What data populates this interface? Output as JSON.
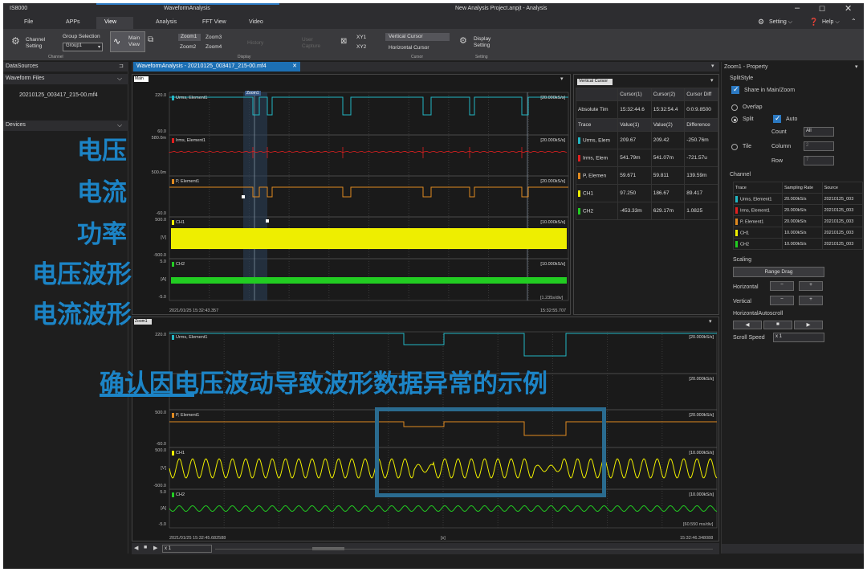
{
  "titlebar": {
    "app": "IS8000",
    "doc": "WaveformAnalysis",
    "project": "New Analysis Project.anpjt - Analysis",
    "setting": "Setting",
    "help": "Help"
  },
  "tabs": [
    "File",
    "APPs",
    "View",
    "Analysis",
    "FFT View",
    "Video"
  ],
  "ribbon": {
    "channel_setting": "Channel Setting",
    "channel_group": "Channel",
    "group_selection": "Group Selection",
    "group_value": "Group1",
    "main_view": "Main View",
    "zoom1": "Zoom1",
    "zoom2": "Zoom2",
    "zoom3": "Zoom3",
    "zoom4": "Zoom4",
    "history": "History",
    "user_capture": "User Capture",
    "display_group": "Display",
    "xy1": "XY1",
    "xy2": "XY2",
    "vertical_cursor": "Vertical Cursor",
    "horizontal_cursor": "Horizontal Cursor",
    "cursor_group": "Cursor",
    "display_setting": "Display Setting",
    "setting_group": "Setting"
  },
  "datasources": {
    "title": "DataSources",
    "waveform_files": "Waveform Files",
    "file": "20210125_003417_215-00.mf4",
    "devices": "Devices"
  },
  "doc_tab": "WaveformAnalysis - 20210125_003417_215-00.mf4",
  "main": {
    "label": "Main",
    "start_time": "2021/01/25 15:32:43.357",
    "end_time": "15:32:55.707",
    "div": "[1.235s/div]",
    "zoom_tag": "Zoom1",
    "traces": [
      {
        "name": "Urms, Element1",
        "color": "#22b7c4",
        "top": "220.0",
        "mid": "",
        "bottom": "60.0",
        "rate": "[20.000kS/s]"
      },
      {
        "name": "Irms, Element1",
        "color": "#e02020",
        "top": "580.0m",
        "mid": "",
        "bottom": "500.0m",
        "rate": "[20.000kS/s]"
      },
      {
        "name": "P, Element1",
        "color": "#e08a20",
        "top": "",
        "mid": "",
        "bottom": "-60.0",
        "rate": "[20.000kS/s]"
      },
      {
        "name": "CH1",
        "color": "#eeee00",
        "top": "500.0",
        "mid": "[V]",
        "bottom": "-500.0",
        "rate": "[10.000kS/s]"
      },
      {
        "name": "CH2",
        "color": "#22cc22",
        "top": "5.0",
        "mid": "[A]",
        "bottom": "-5.0",
        "rate": "[10.000kS/s]"
      }
    ]
  },
  "zoom": {
    "label": "Zoom1",
    "start_time": "2021/01/25 15:32:45.682588",
    "end_time": "15:32:46.348088",
    "div": "[60.550 ms/div]",
    "xunit": "[s]",
    "traces": [
      {
        "name": "Urms, Element1",
        "top": "220.0",
        "mid": "",
        "bottom": "",
        "rate": "[20.000kS/s]"
      },
      {
        "name": "",
        "top": "",
        "mid": "",
        "bottom": "",
        "rate": "[20.000kS/s]"
      },
      {
        "name": "P, Element1",
        "top": "500.0",
        "mid": "",
        "bottom": "-60.0",
        "rate": "[20.000kS/s]"
      },
      {
        "name": "CH1",
        "top": "500.0",
        "mid": "[V]",
        "bottom": "-500.0",
        "rate": "[10.000kS/s]"
      },
      {
        "name": "CH2",
        "top": "5.0",
        "mid": "[A]",
        "bottom": "-5.0",
        "rate": "[10.000kS/s]"
      }
    ]
  },
  "cursor": {
    "title": "Vertical Cursor",
    "col1": "Cursor(1)",
    "col2": "Cursor(2)",
    "col3": "Cursor Diff",
    "abs_label": "Absolute Tim",
    "abs1": "15:32:44.6",
    "abs2": "15:32:54.4",
    "absd": "0:0:9.8500",
    "hdr": [
      "Trace",
      "Value(1)",
      "Value(2)",
      "Difference"
    ],
    "rows": [
      {
        "name": "Urms, Elem",
        "color": "#22b7c4",
        "v1": "209.67",
        "v2": "209.42",
        "d": "-250.76m"
      },
      {
        "name": "Irms, Elem",
        "color": "#e02020",
        "v1": "541.79m",
        "v2": "541.07m",
        "d": "-721.57u"
      },
      {
        "name": "P, Elemen",
        "color": "#e08a20",
        "v1": "59.671",
        "v2": "59.811",
        "d": "139.59m"
      },
      {
        "name": "CH1",
        "color": "#eeee00",
        "v1": "97.250",
        "v2": "186.67",
        "d": "89.417"
      },
      {
        "name": "CH2",
        "color": "#22cc22",
        "v1": "-453.33m",
        "v2": "629.17m",
        "d": "1.0825"
      }
    ]
  },
  "property": {
    "title": "Zoom1 - Property",
    "split_style": "SplitStyle",
    "share": "Share in Main/Zoom",
    "overlap": "Overlap",
    "split": "Split",
    "auto": "Auto",
    "count": "Count",
    "count_val": "All",
    "tile": "Tile",
    "column": "Column",
    "column_val": "2",
    "row": "Row",
    "row_val": "7",
    "channel": "Channel",
    "ch_hdr": [
      "Trace",
      "Sampling Rate",
      "Source"
    ],
    "ch_rows": [
      {
        "name": "Urms, Element1",
        "color": "#22b7c4",
        "rate": "20.000kS/s",
        "src": "20210125_003"
      },
      {
        "name": "Irms, Element1",
        "color": "#e02020",
        "rate": "20.000kS/s",
        "src": "20210125_003"
      },
      {
        "name": "P, Element1",
        "color": "#e08a20",
        "rate": "20.000kS/s",
        "src": "20210125_003"
      },
      {
        "name": "CH1",
        "color": "#eeee00",
        "rate": "10.000kS/s",
        "src": "20210125_003"
      },
      {
        "name": "CH2",
        "color": "#22cc22",
        "rate": "10.000kS/s",
        "src": "20210125_003"
      }
    ],
    "scaling": "Scaling",
    "range_drag": "Range Drag",
    "horizontal": "Horizontal",
    "vertical": "Vertical",
    "hautoscroll": "HorizontalAutoscroll",
    "scroll_speed": "Scroll Speed",
    "speed_val": "x 1"
  },
  "bottombar": {
    "speed": "x 1"
  },
  "overlay": {
    "voltage": "电压",
    "current": "电流",
    "power": "功率",
    "voltage_wave": "电压波形",
    "current_wave": "电流波形",
    "caption": "确认因电压波动导致波形数据异常的示例"
  }
}
